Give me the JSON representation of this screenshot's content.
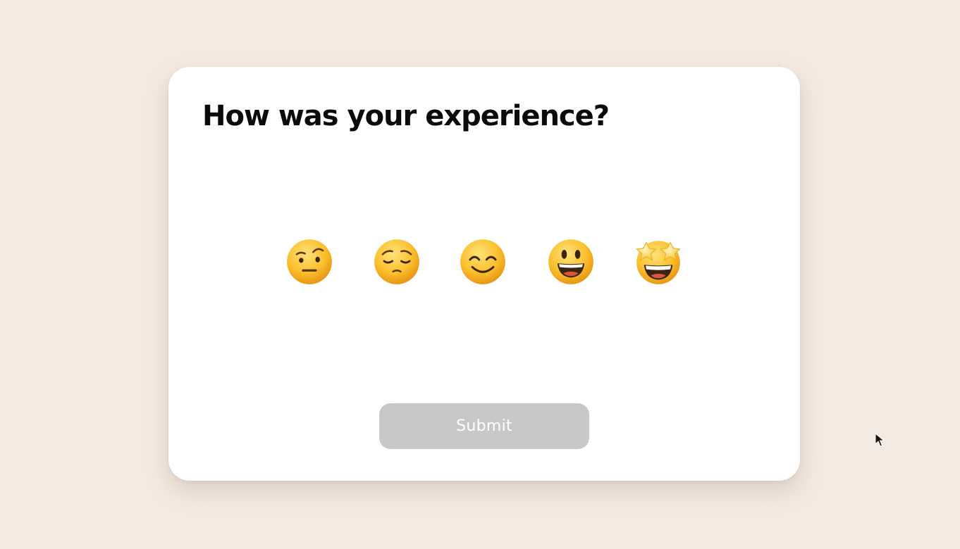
{
  "survey": {
    "title": "How was your experience?",
    "submit_label": "Submit",
    "submit_state": "disabled"
  },
  "emojis": [
    {
      "name": "face-with-raised-eyebrow-icon"
    },
    {
      "name": "pensive-face-icon"
    },
    {
      "name": "smiling-face-with-smiling-eyes-icon"
    },
    {
      "name": "grinning-face-with-big-eyes-icon"
    },
    {
      "name": "star-struck-icon"
    }
  ],
  "colors": {
    "background": "#f4e9e1",
    "card": "#ffffff",
    "title_text": "#0b0b0b",
    "submit_bg_disabled": "#c7c7c7",
    "submit_text": "#ffffff",
    "emoji_yellow": "#fbc531"
  }
}
